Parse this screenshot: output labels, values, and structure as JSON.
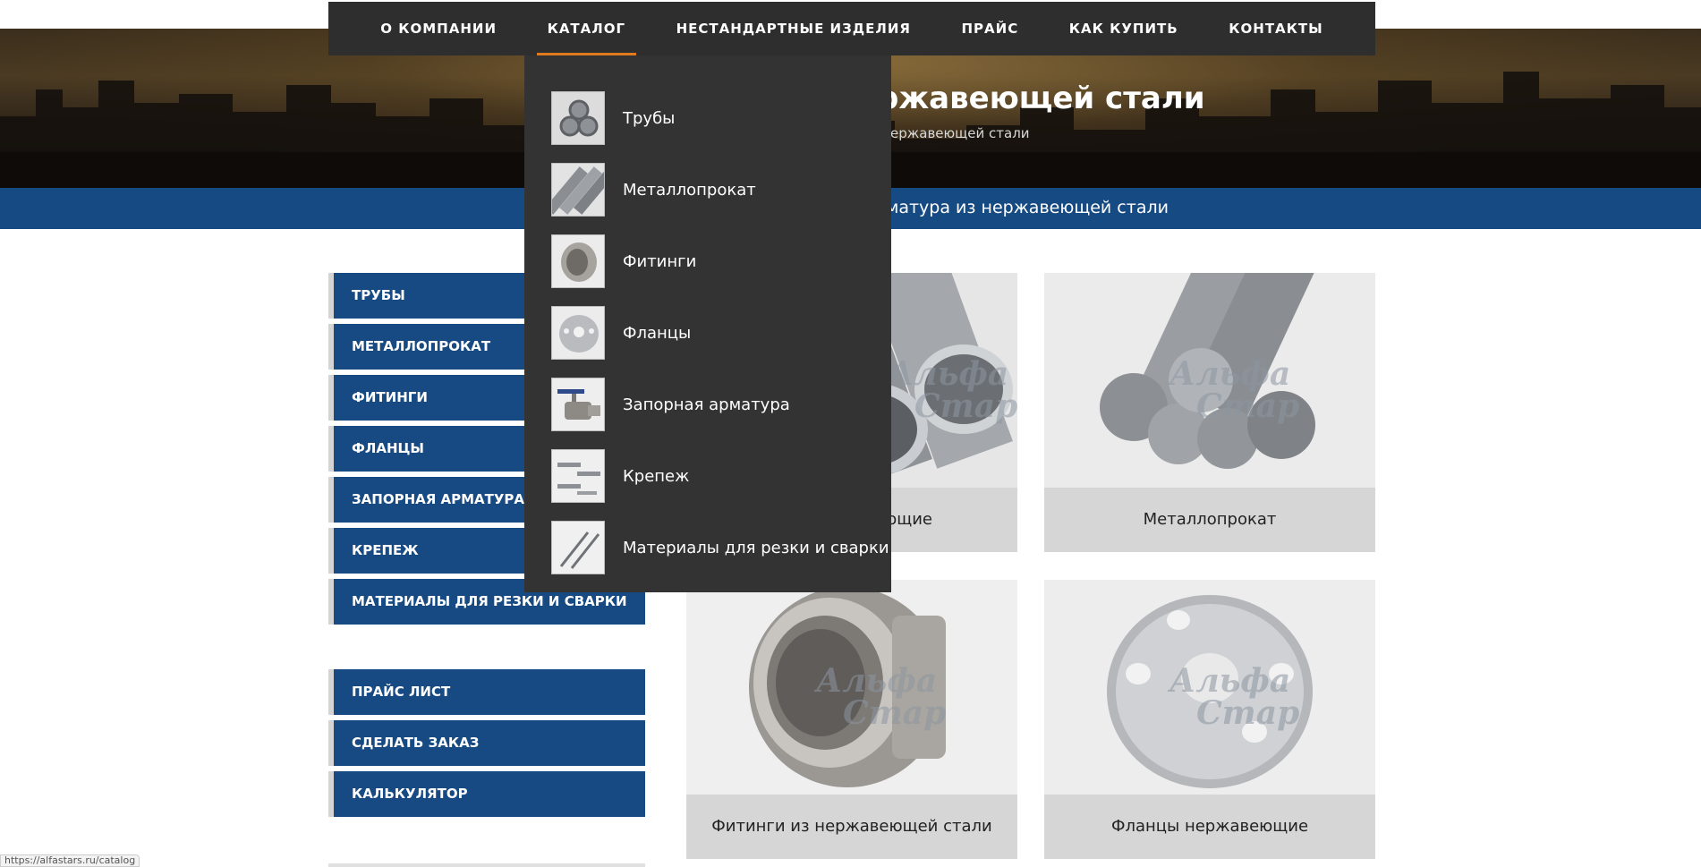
{
  "nav": {
    "items": [
      "О КОМПАНИИ",
      "КАТАЛОГ",
      "НЕСТАНДАРТНЫЕ ИЗДЕЛИЯ",
      "ПРАЙС",
      "КАК КУПИТЬ",
      "КОНТАКТЫ"
    ],
    "active": "КАТАЛОГ"
  },
  "hero": {
    "title": "ржавеющей стали",
    "crumb": "ержавеющей стали"
  },
  "band": {
    "text": "матура из нержавеющей стали"
  },
  "dropdown": {
    "items": [
      "Трубы",
      "Металлопрокат",
      "Фитинги",
      "Фланцы",
      "Запорная арматура",
      "Крепеж",
      "Материалы для резки и сварки"
    ]
  },
  "sidebar": {
    "catalog": [
      "ТРУБЫ",
      "МЕТАЛЛОПРОКАТ",
      "ФИТИНГИ",
      "ФЛАНЦЫ",
      "ЗАПОРНАЯ АРМАТУРА",
      "КРЕПЕЖ",
      "МАТЕРИАЛЫ ДЛЯ РЕЗКИ И СВАРКИ"
    ],
    "extra": [
      "ПРАЙС ЛИСТ",
      "СДЕЛАТЬ ЗАКАЗ",
      "КАЛЬКУЛЯТОР"
    ]
  },
  "cards": {
    "c1": "ющие",
    "c2": "Металлопрокат",
    "c3": "Фитинги из нержавеющей стали",
    "c4": "Фланцы нержавеющие"
  },
  "watermark": {
    "line1": "Альфа",
    "line2": "Стар"
  },
  "status": {
    "url": "https://alfastars.ru/catalog"
  },
  "colors": {
    "nav_bg": "#2e2e2e",
    "accent": "#e07a1f",
    "brand_blue": "#164a82"
  }
}
